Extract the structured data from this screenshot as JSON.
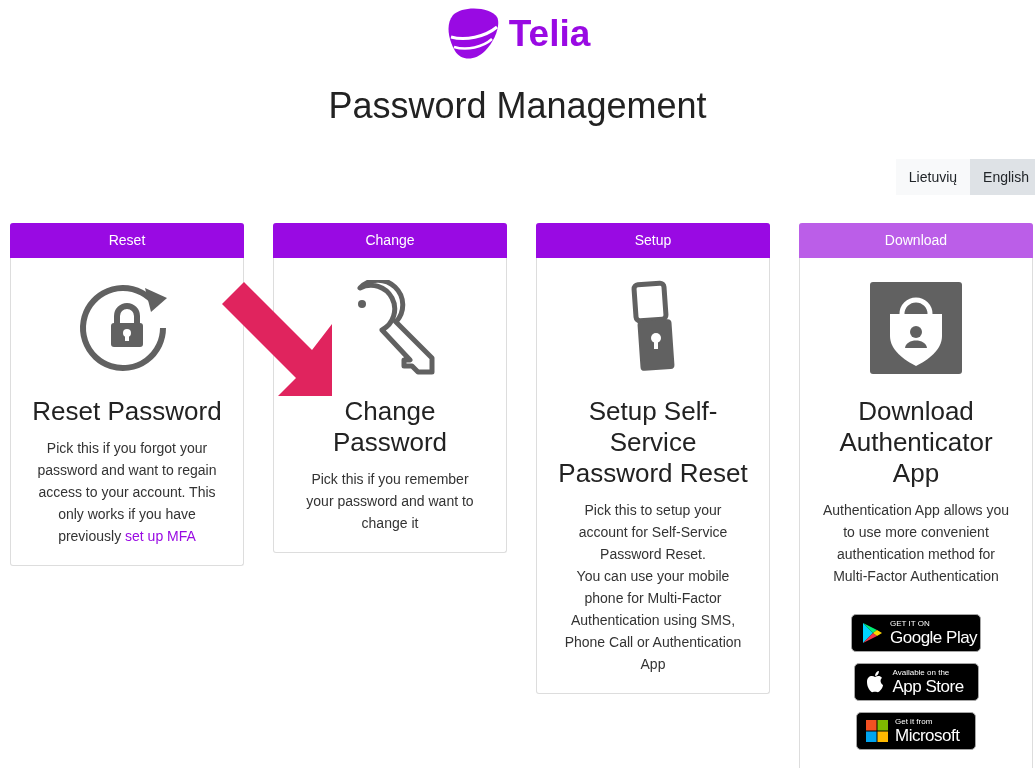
{
  "logo": {
    "text": "Telia"
  },
  "title": "Password Management",
  "languages": [
    {
      "label": "Lietuvių",
      "selected": false
    },
    {
      "label": "English",
      "selected": true
    }
  ],
  "cards": [
    {
      "kind": "reset",
      "header": "Reset",
      "highlighted": false,
      "title": "Reset Password",
      "paragraphs": [
        {
          "text": "Pick this if you forgot your password and want to regain access to your account. This only works if you have previously",
          "link": "set up MFA"
        }
      ]
    },
    {
      "kind": "change",
      "header": "Change",
      "highlighted": false,
      "title": "Change Password",
      "paragraphs": [
        {
          "text": "Pick this if you remember your password and want to change it"
        }
      ]
    },
    {
      "kind": "setup",
      "header": "Setup",
      "highlighted": false,
      "title": "Setup Self-Service Password Reset",
      "paragraphs": [
        {
          "text": "Pick this to setup your account for Self-Service Password Reset."
        },
        {
          "text": "You can use your mobile phone for Multi-Factor Authentication using SMS, Phone Call or Authentication App"
        }
      ]
    },
    {
      "kind": "download",
      "header": "Download",
      "highlighted": true,
      "title": "Download Authenticator App",
      "paragraphs": [
        {
          "text": "Authentication App allows you to use more convenient authentication method for Multi-Factor Authentication"
        }
      ],
      "store_badges": [
        {
          "kind": "google",
          "small": "GET IT ON",
          "big": "Google Play"
        },
        {
          "kind": "apple",
          "small": "Available on the",
          "big": "App Store"
        },
        {
          "kind": "microsoft",
          "small": "Get it from",
          "big": "Microsoft"
        }
      ]
    }
  ]
}
